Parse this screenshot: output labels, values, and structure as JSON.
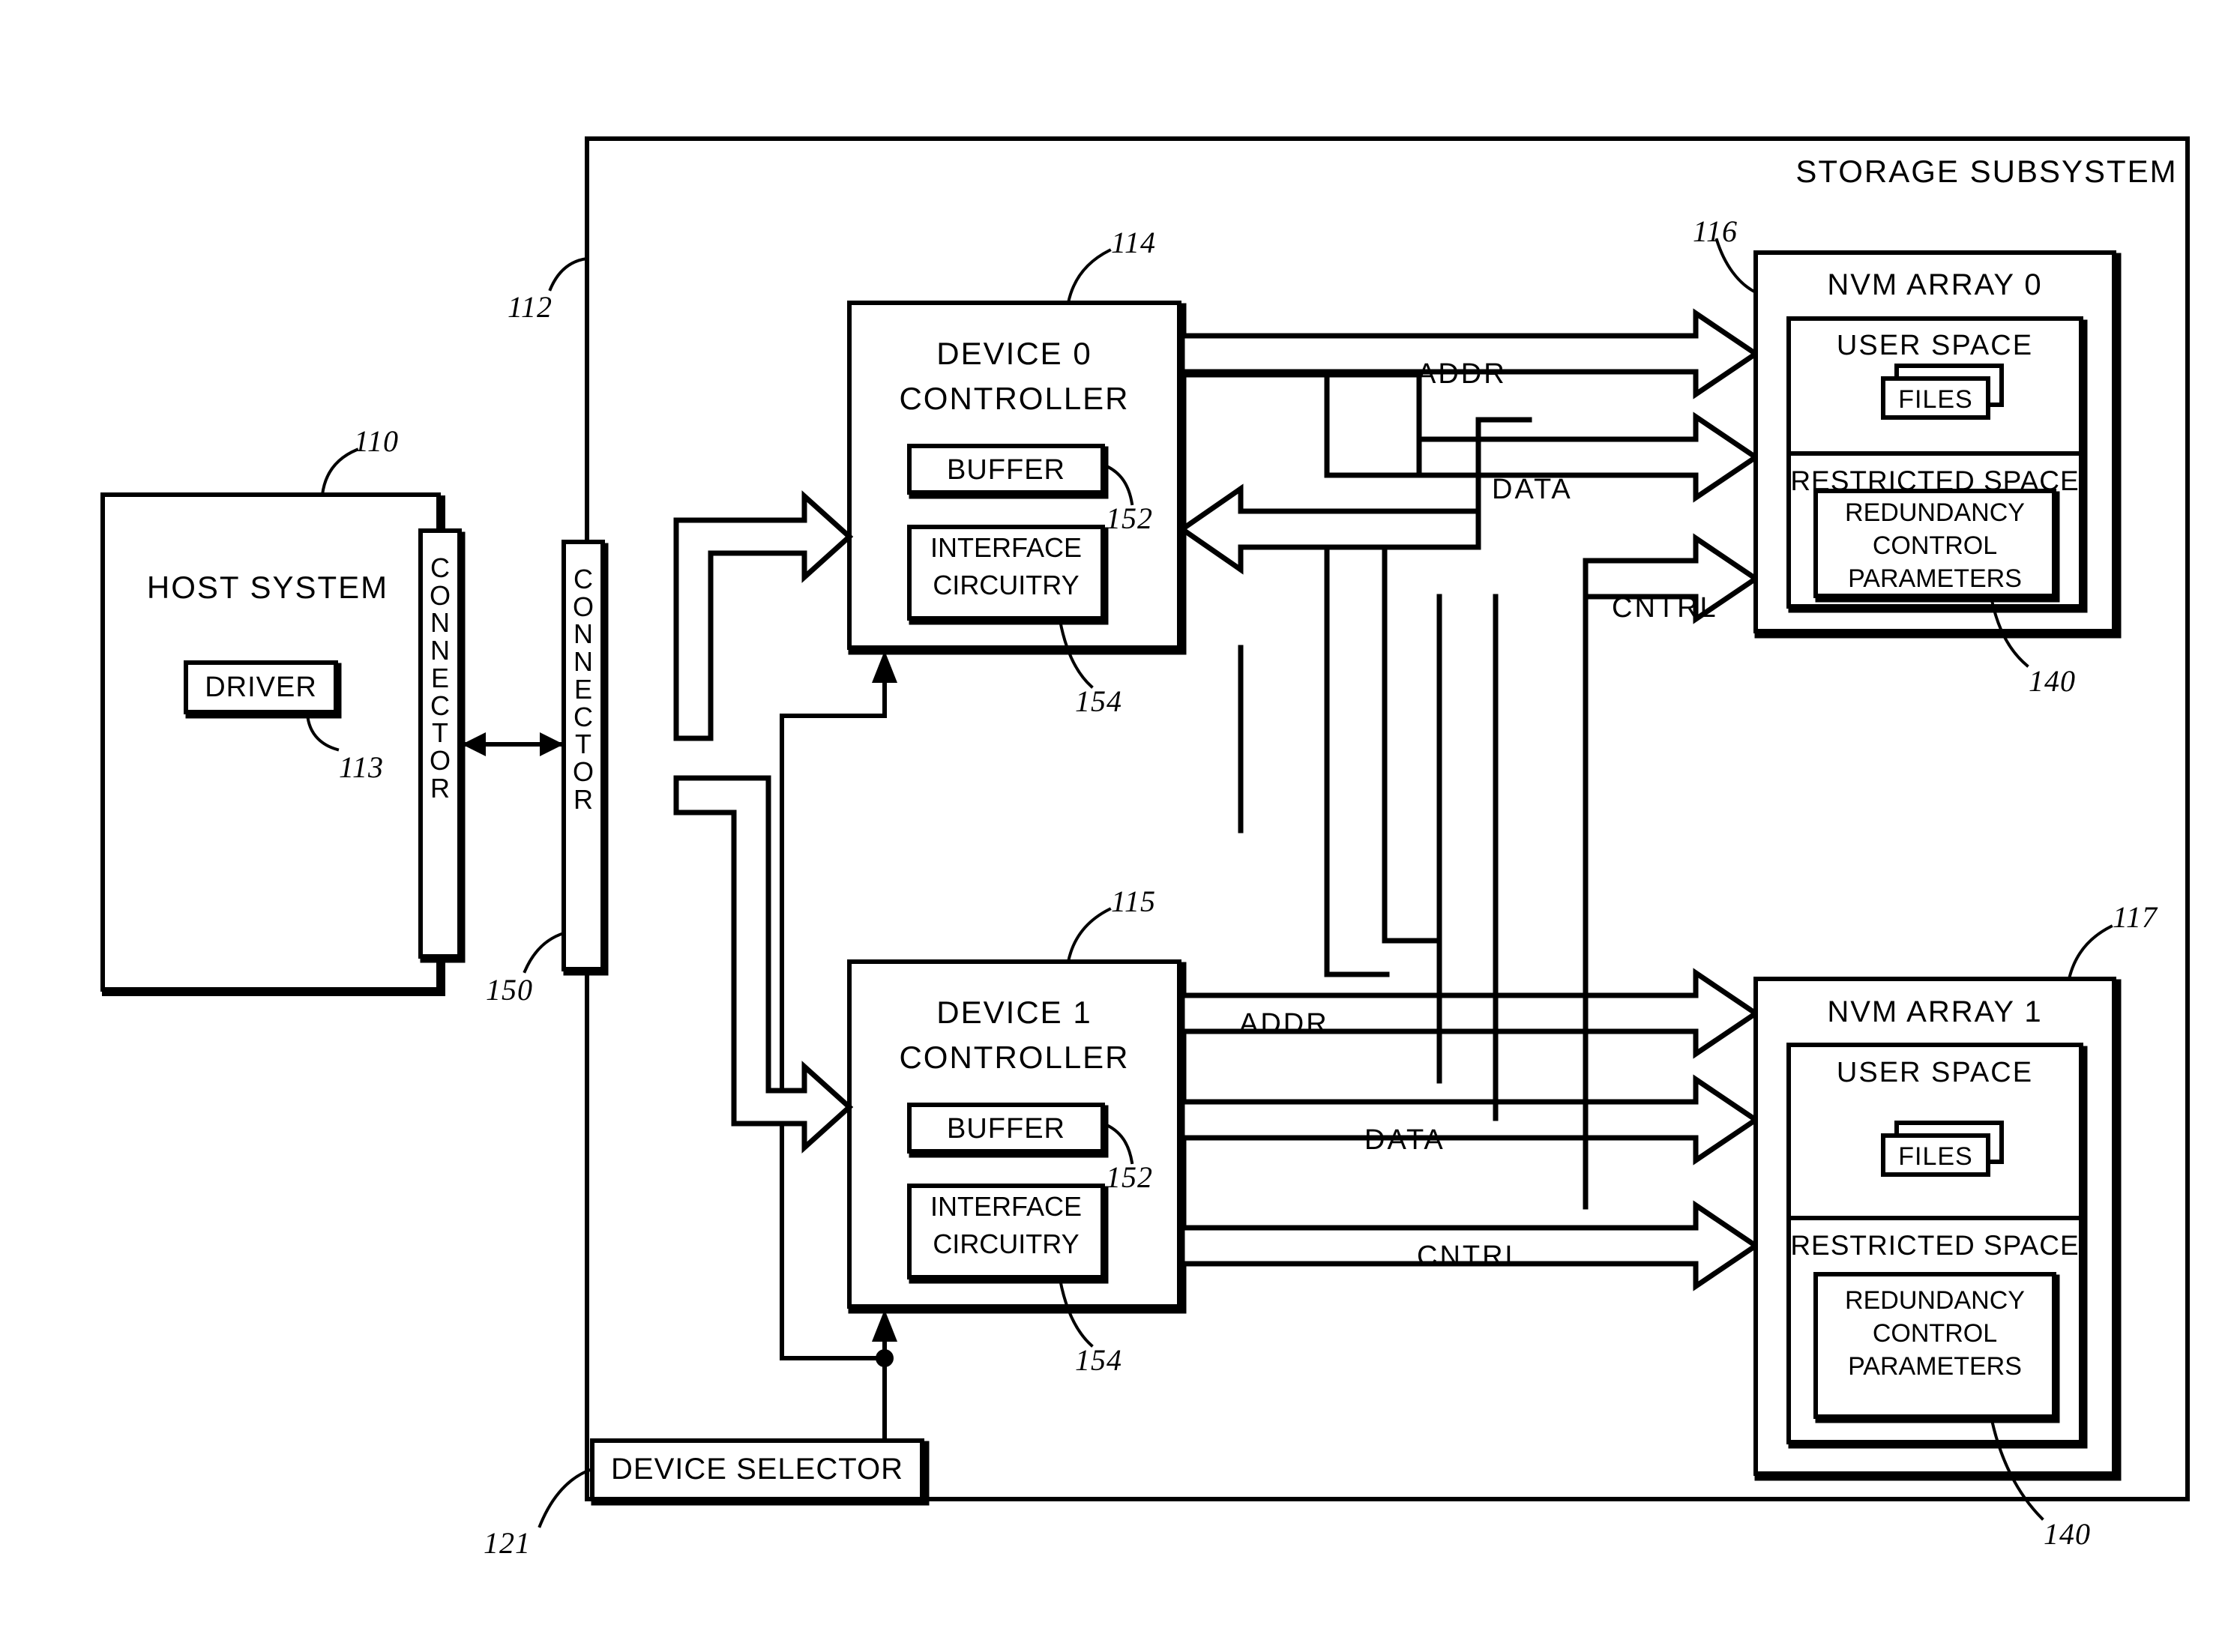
{
  "figure": {
    "type": "patent-block-diagram",
    "subsystem_title": "STORAGE SUBSYSTEM"
  },
  "host": {
    "title": "HOST SYSTEM",
    "ref": "110",
    "driver_label": "DRIVER",
    "driver_ref": "113",
    "connector_label": "CONNECTOR"
  },
  "subsystem": {
    "title": "STORAGE SUBSYSTEM",
    "ref": "112",
    "connector_label": "CONNECTOR",
    "connector_ref": "150",
    "device_selector_label": "DEVICE SELECTOR",
    "device_selector_ref": "121"
  },
  "controllers": [
    {
      "title_line1": "DEVICE 0",
      "title_line2": "CONTROLLER",
      "ref": "114",
      "buffer_label": "BUFFER",
      "buffer_ref": "152",
      "interface_line1": "INTERFACE",
      "interface_line2": "CIRCUITRY",
      "interface_ref": "154"
    },
    {
      "title_line1": "DEVICE 1",
      "title_line2": "CONTROLLER",
      "ref": "115",
      "buffer_label": "BUFFER",
      "buffer_ref": "152",
      "interface_line1": "INTERFACE",
      "interface_line2": "CIRCUITRY",
      "interface_ref": "154"
    }
  ],
  "arrays": [
    {
      "title": "NVM ARRAY 0",
      "ref": "116",
      "user_space_label": "USER SPACE",
      "files_label": "FILES",
      "restricted_space_label": "RESTRICTED SPACE",
      "params_line1": "REDUNDANCY",
      "params_line2": "CONTROL",
      "params_line3": "PARAMETERS",
      "params_ref": "140"
    },
    {
      "title": "NVM ARRAY 1",
      "ref": "117",
      "user_space_label": "USER SPACE",
      "files_label": "FILES",
      "restricted_space_label": "RESTRICTED SPACE",
      "params_line1": "REDUNDANCY",
      "params_line2": "CONTROL",
      "params_line3": "PARAMETERS",
      "params_ref": "140"
    }
  ],
  "buses": {
    "top": {
      "addr": "ADDR",
      "data": "DATA",
      "cntrl": "CNTRL"
    },
    "bottom": {
      "addr": "ADDR",
      "data": "DATA",
      "cntrl": "CNTRL"
    }
  }
}
